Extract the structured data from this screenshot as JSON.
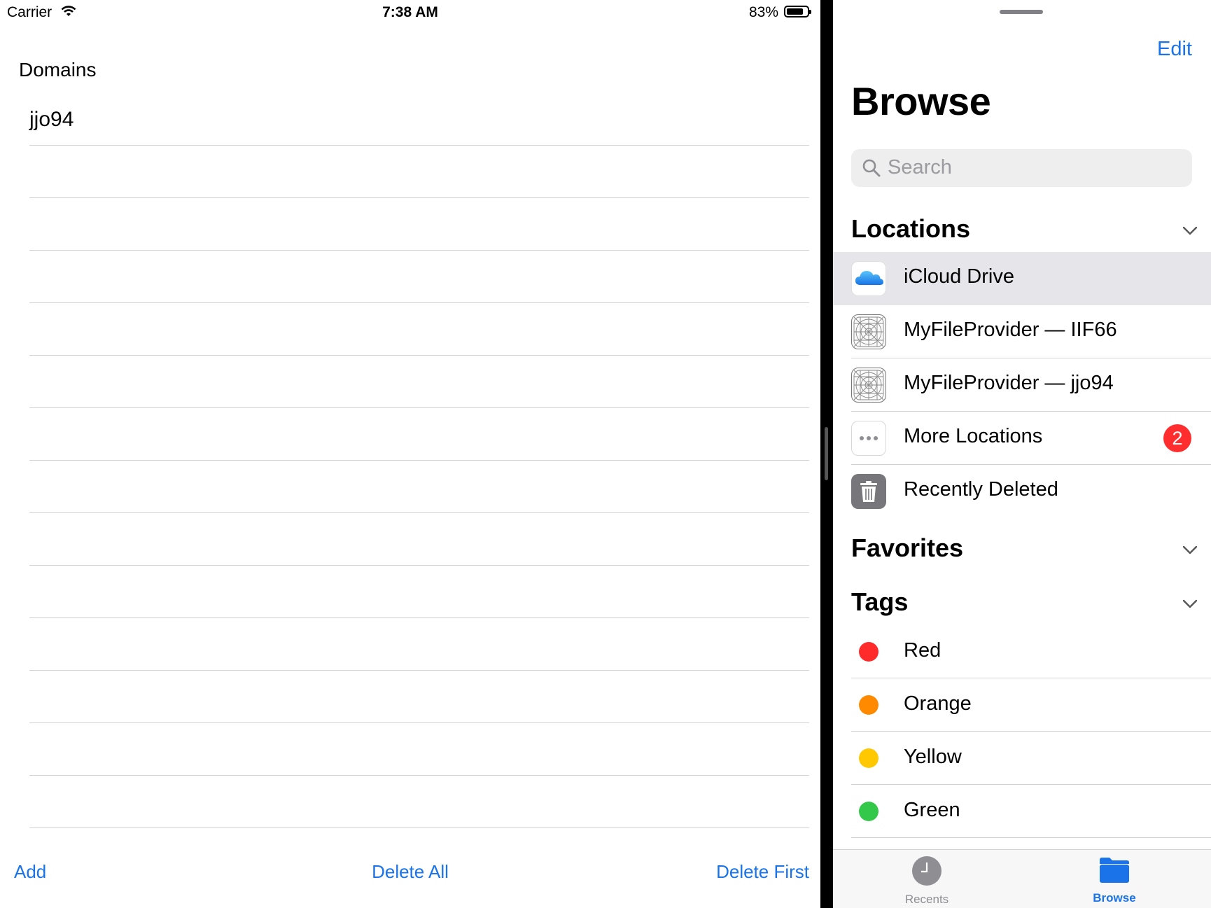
{
  "status_bar": {
    "carrier": "Carrier",
    "time": "7:38 AM",
    "battery_percent": "83%",
    "battery_level": 0.83
  },
  "domains_app": {
    "header": "Domains",
    "rows": [
      "jjo94"
    ],
    "toolbar": {
      "add_label": "Add",
      "delete_all_label": "Delete All",
      "delete_first_label": "Delete First"
    }
  },
  "files_app": {
    "edit_label": "Edit",
    "title": "Browse",
    "search_placeholder": "Search",
    "locations": {
      "header": "Locations",
      "items": [
        {
          "label": "iCloud Drive",
          "icon": "icloud-icon",
          "selected": true
        },
        {
          "label": "MyFileProvider — IIF66",
          "icon": "app-placeholder-icon"
        },
        {
          "label": "MyFileProvider — jjo94",
          "icon": "app-placeholder-icon"
        },
        {
          "label": "More Locations",
          "icon": "ellipsis-icon",
          "badge": "2"
        },
        {
          "label": "Recently Deleted",
          "icon": "trash-icon"
        }
      ]
    },
    "favorites": {
      "header": "Favorites"
    },
    "tags": {
      "header": "Tags",
      "items": [
        {
          "label": "Red",
          "color": "#ff2a2a"
        },
        {
          "label": "Orange",
          "color": "#ff8a00"
        },
        {
          "label": "Yellow",
          "color": "#ffc800"
        },
        {
          "label": "Green",
          "color": "#34c84a"
        }
      ]
    },
    "tab_bar": {
      "recents_label": "Recents",
      "browse_label": "Browse"
    },
    "colors": {
      "accent": "#1a73e8",
      "badge": "#ff2d2d"
    }
  }
}
